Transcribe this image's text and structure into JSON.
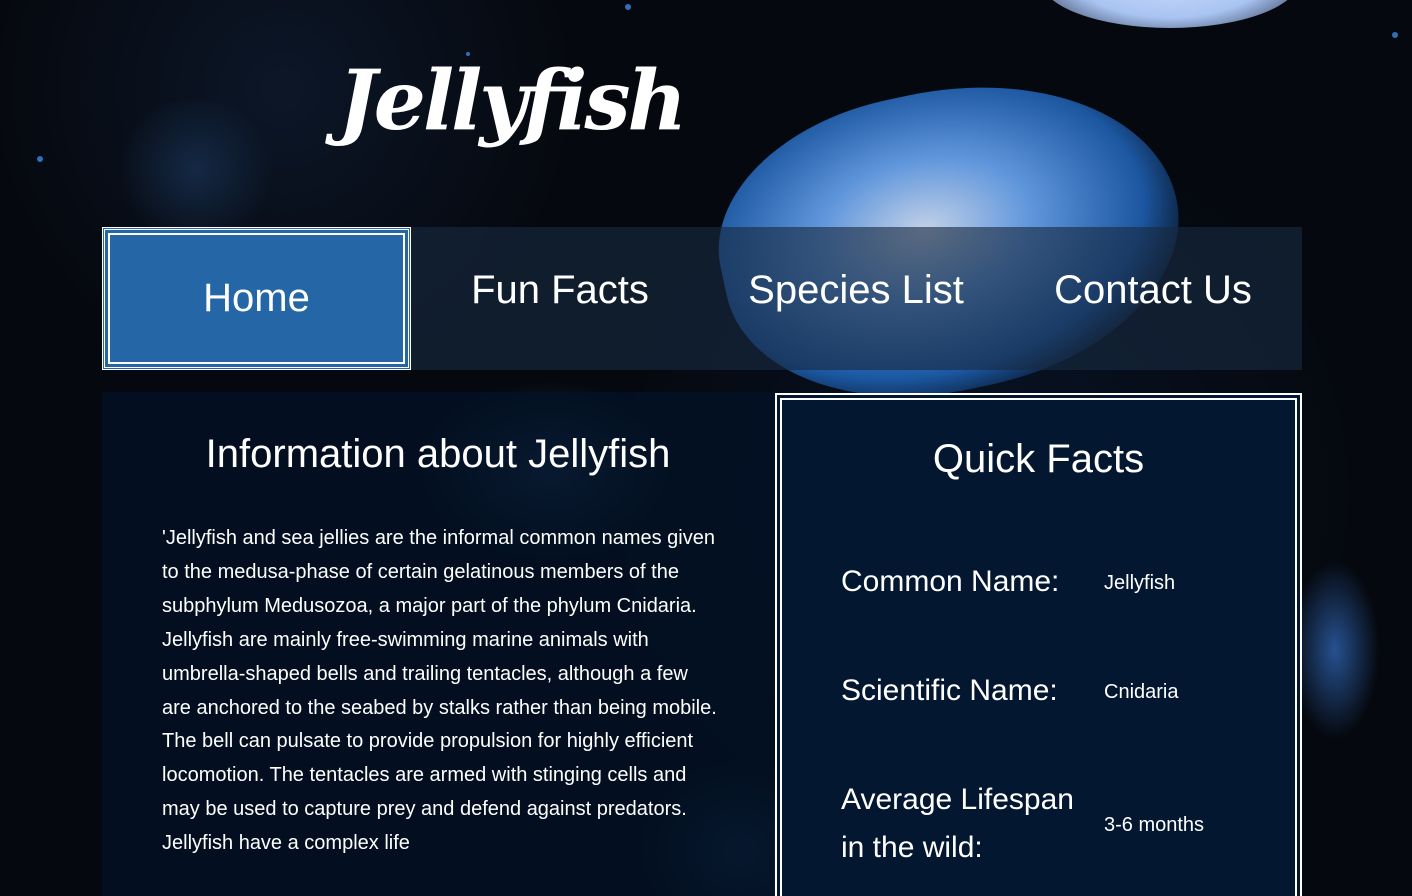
{
  "site": {
    "logo_text": "Jellyfish"
  },
  "nav": {
    "items": [
      {
        "label": "Home",
        "active": true
      },
      {
        "label": "Fun Facts",
        "active": false
      },
      {
        "label": "Species List",
        "active": false
      },
      {
        "label": "Contact Us",
        "active": false
      }
    ]
  },
  "info": {
    "title": "Information about Jellyfish",
    "body": "'Jellyfish and sea jellies are the informal common names given to the medusa-phase of certain gelatinous members of the subphylum Medusozoa, a major part of the phylum Cnidaria. Jellyfish are mainly free-swimming marine animals with umbrella-shaped bells and trailing tentacles, although a few are anchored to the seabed by stalks rather than being mobile. The bell can pulsate to provide propulsion for highly efficient locomotion. The tentacles are armed with stinging cells and may be used to capture prey and defend against predators. Jellyfish have a complex life"
  },
  "quick_facts": {
    "title": "Quick Facts",
    "rows": [
      {
        "label": "Common Name:",
        "value": "Jellyfish"
      },
      {
        "label": "Scientific Name:",
        "value": "Cnidaria"
      },
      {
        "label": "Average Lifespan in the wild:",
        "value": "3-6 months"
      }
    ]
  },
  "colors": {
    "nav_active": "#2466a6",
    "nav_bar": "#192a40",
    "facts_bg": "#031730",
    "page_bg": "#05080e"
  }
}
